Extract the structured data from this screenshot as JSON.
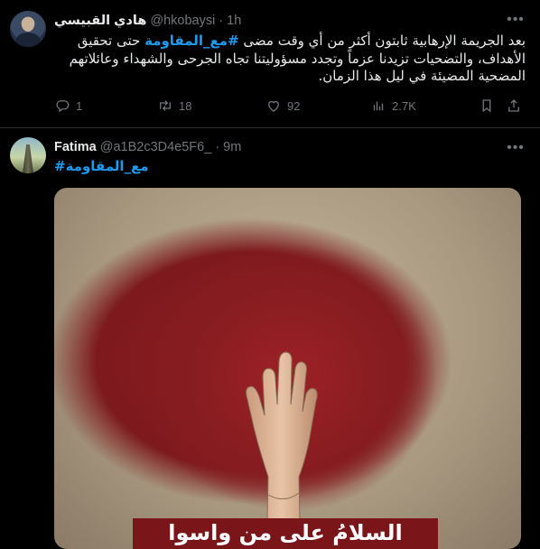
{
  "tweets": [
    {
      "display_name": "هادي القبيسي",
      "handle": "@hkobaysi",
      "separator": "·",
      "time": "1h",
      "text_before": "بعد الجريمة الإرهابية ثابتون أكثر من أي وقت مضى ",
      "hashtag": "#مع_المقاومة",
      "text_after": " حتى تحقيق الأهداف، والتضحيات تزيدنا عزماً وتجدد مسؤوليتنا تجاه الجرحى والشهداء وعائلاتهم المضحية المضيئة في ليل هذا الزمان.",
      "stats": {
        "replies": "1",
        "reposts": "18",
        "likes": "92",
        "views": "2.7K"
      }
    },
    {
      "display_name": "Fatima",
      "handle": "@a1B2c3D4e5F6_",
      "separator": "·",
      "time": "9m",
      "hashtag": "#مع_المقاومة",
      "media_caption": "السلامُ على من واسوا كفوفَ"
    }
  ],
  "icons": {
    "more": "more-icon",
    "reply": "reply-icon",
    "repost": "repost-icon",
    "like": "heart-icon",
    "views": "views-icon",
    "bookmark": "bookmark-icon",
    "share": "share-icon"
  },
  "colors": {
    "background": "#000000",
    "text": "#e7e9ea",
    "muted": "#71767b",
    "link": "#1d9bf0",
    "divider": "#2f3336"
  }
}
